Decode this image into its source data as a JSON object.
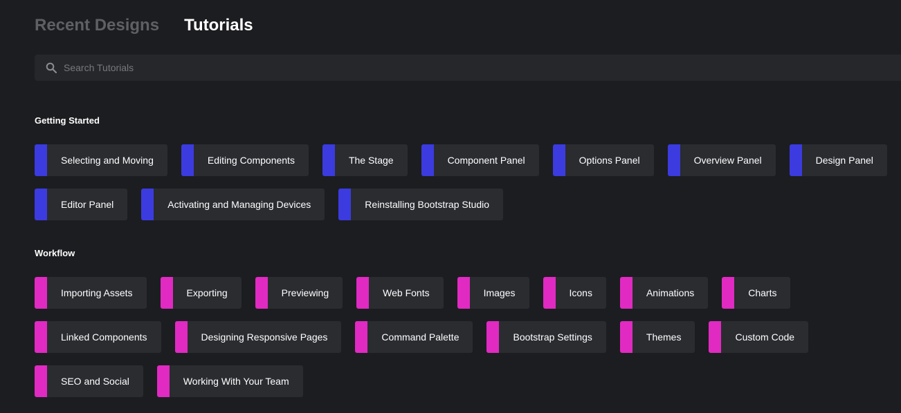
{
  "tabs": [
    {
      "label": "Recent Designs",
      "active": false
    },
    {
      "label": "Tutorials",
      "active": true
    }
  ],
  "search": {
    "placeholder": "Search Tutorials",
    "value": ""
  },
  "colors": {
    "getting_started_accent": "#3b3be0",
    "workflow_accent": "#e02ac2"
  },
  "sections": [
    {
      "title": "Getting Started",
      "rows": [
        [
          "Selecting and Moving",
          "Editing Components",
          "The Stage",
          "Component Panel",
          "Options Panel",
          "Overview Panel",
          "Design Panel"
        ],
        [
          "Editor Panel",
          "Activating and Managing Devices",
          "Reinstalling Bootstrap Studio"
        ]
      ]
    },
    {
      "title": "Workflow",
      "rows": [
        [
          "Importing Assets",
          "Exporting",
          "Previewing",
          "Web Fonts",
          "Images",
          "Icons",
          "Animations",
          "Charts"
        ],
        [
          "Linked Components",
          "Designing Responsive Pages",
          "Command Palette",
          "Bootstrap Settings",
          "Themes",
          "Custom Code"
        ],
        [
          "SEO and Social",
          "Working With Your Team"
        ]
      ]
    }
  ]
}
